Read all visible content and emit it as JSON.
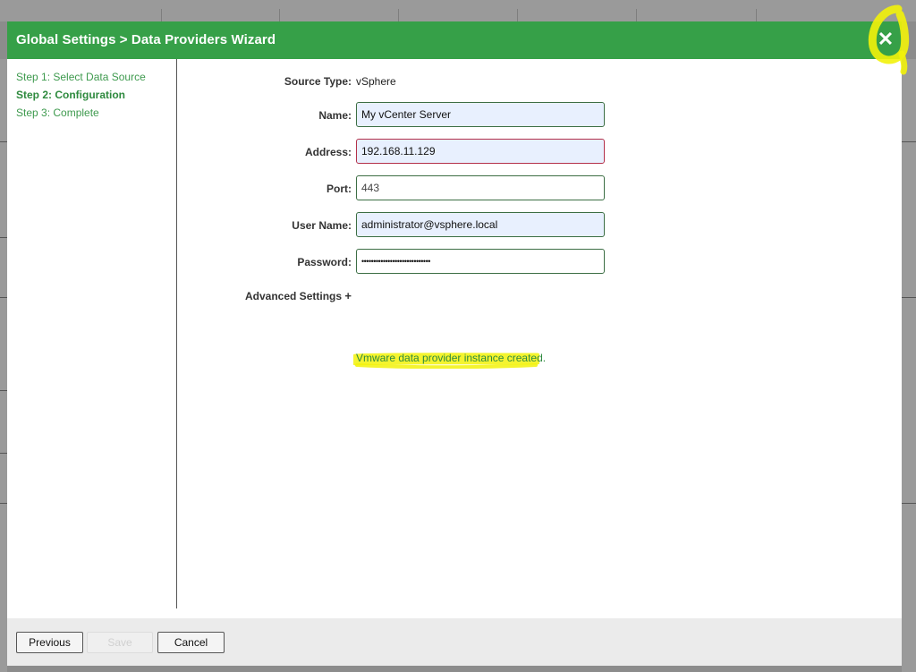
{
  "modal": {
    "title": "Global Settings > Data Providers Wizard",
    "close_icon": "close-icon"
  },
  "steps": [
    {
      "label": "Step 1: Select Data Source",
      "active": false
    },
    {
      "label": "Step 2: Configuration",
      "active": true
    },
    {
      "label": "Step 3: Complete",
      "active": false
    }
  ],
  "form": {
    "source_type_label": "Source Type:",
    "source_type_value": "vSphere",
    "name_label": "Name:",
    "name_value": "My vCenter Server",
    "address_label": "Address:",
    "address_value": "192.168.11.129",
    "port_label": "Port:",
    "port_value": "443",
    "username_label": "User Name:",
    "username_value": "administrator@vsphere.local",
    "password_label": "Password:",
    "password_value": "•••••••••••••••••••••••••••••",
    "advanced_label": "Advanced Settings",
    "advanced_icon": "plus-icon"
  },
  "status": {
    "message": "Vmware data provider instance created."
  },
  "footer": {
    "previous_label": "Previous",
    "save_label": "Save",
    "cancel_label": "Cancel"
  },
  "colors": {
    "header_bg": "#36a048",
    "step_text": "#3e9a4e",
    "success_text": "#2e8a3e",
    "highlighter": "#f2f20a"
  }
}
